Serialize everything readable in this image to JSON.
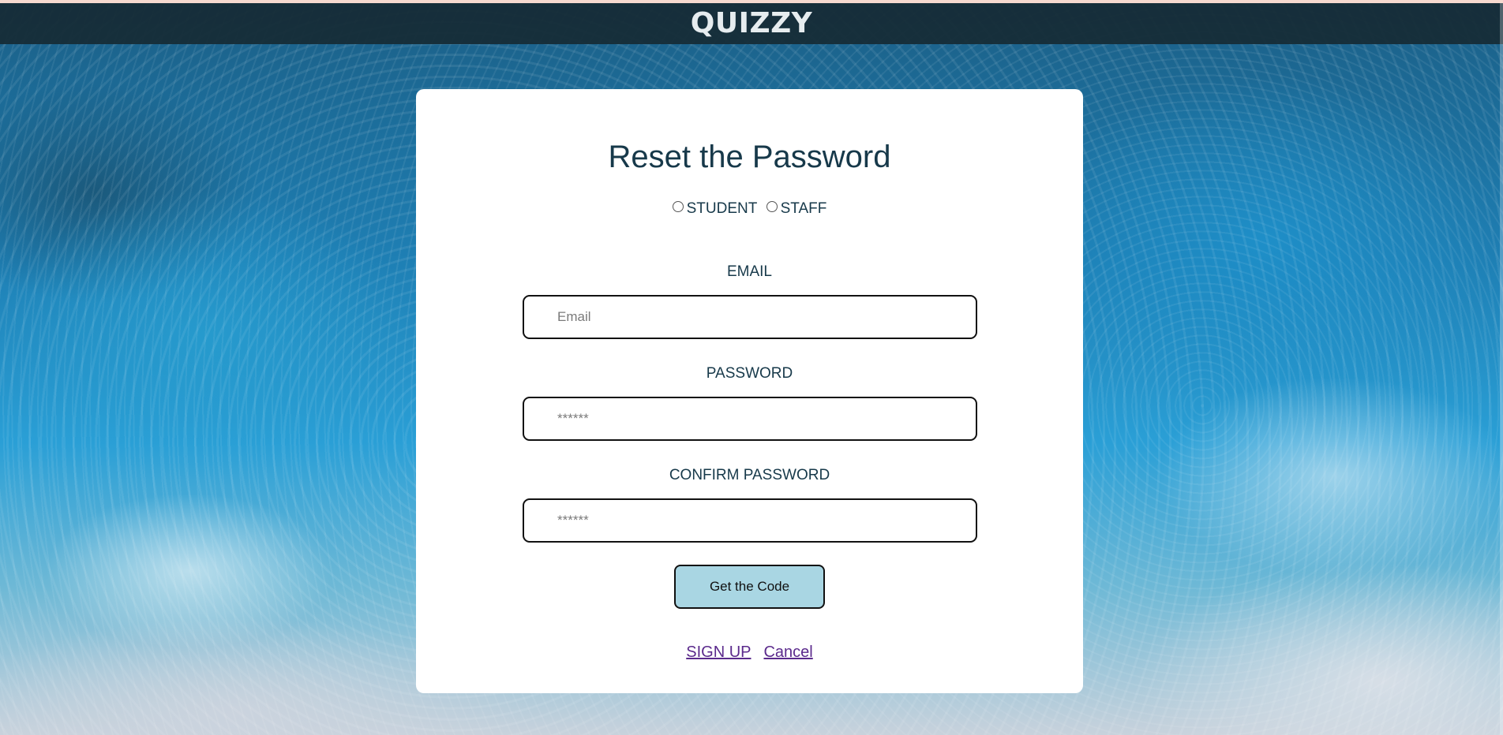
{
  "app": {
    "title": "QUIZZY"
  },
  "form": {
    "title": "Reset the Password",
    "roles": [
      {
        "label": "STUDENT",
        "selected": false
      },
      {
        "label": "STAFF",
        "selected": false
      }
    ],
    "email": {
      "label": "EMAIL",
      "placeholder": "Email",
      "value": ""
    },
    "password": {
      "label": "PASSWORD",
      "placeholder": "******",
      "value": ""
    },
    "confirm_password": {
      "label": "CONFIRM PASSWORD",
      "placeholder": "******",
      "value": ""
    },
    "submit_label": "Get the Code",
    "links": {
      "signup": "SIGN UP",
      "cancel": "Cancel"
    }
  },
  "colors": {
    "topbar": "#162a34",
    "text": "#17394a",
    "button_bg": "#a9d6e3",
    "link": "#5b2a8c",
    "card_bg": "#ffffff"
  }
}
